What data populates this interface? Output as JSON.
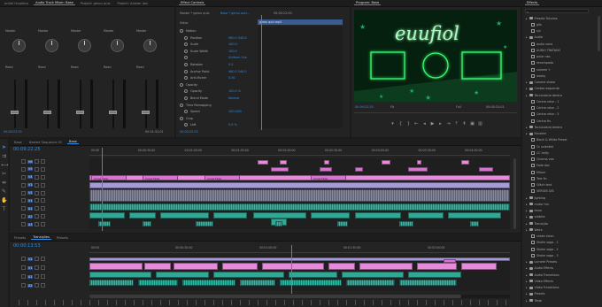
{
  "audio_mixer": {
    "tabs": [
      "ential Graphics",
      "Audio Track Mixer: Base",
      "Project: gerou quiz",
      "Project: Anexer doc"
    ],
    "strips": [
      {
        "route": "Master",
        "label": "Read",
        "db": "0.0"
      },
      {
        "route": "Master",
        "label": "Read",
        "db": "0.0"
      },
      {
        "route": "Master",
        "label": "Read",
        "db": "0.0"
      },
      {
        "route": "Master",
        "label": "Read",
        "db": "0.0"
      },
      {
        "route": "Master",
        "label": "Read",
        "db": "0.0"
      }
    ],
    "footer_left": "00:00:22:25",
    "footer_right": "00:01:31:01"
  },
  "effect_controls": {
    "tab": "Effect Controls",
    "title_left": "Master * gerou quiz.",
    "title_right": "Base * gerou quiz...",
    "video_label": "Video",
    "ruler_time": "00:00:22:00",
    "clip_label": "gerou quiz.mp4",
    "rows": [
      {
        "name": "Motion",
        "value": ""
      },
      {
        "name": "Position",
        "value": "960.0   540.0"
      },
      {
        "name": "Scale",
        "value": "100.0"
      },
      {
        "name": "Scale Width",
        "value": "100.0"
      },
      {
        "name": "",
        "value": "Uniform Sca"
      },
      {
        "name": "Rotation",
        "value": "0.0"
      },
      {
        "name": "Anchor Point",
        "value": "960.0   540.0"
      },
      {
        "name": "Anti-flicker",
        "value": "0.00"
      },
      {
        "name": "Opacity",
        "value": ""
      },
      {
        "name": "Opacity",
        "value": "100.0 %"
      },
      {
        "name": "Blend Mode",
        "value": "Normal"
      },
      {
        "name": "Time Remapping",
        "value": ""
      },
      {
        "name": "Speed",
        "value": "100.00%"
      },
      {
        "name": "Crop",
        "value": ""
      },
      {
        "name": "Left",
        "value": "0.0 %"
      }
    ],
    "footer_time": "00:00:22:25"
  },
  "program": {
    "tab": "Program: Base",
    "neon_text": "euufiol",
    "timecode": "00:09:22:25",
    "fit": "Fit",
    "quality": "Full",
    "duration": "00:00:31:01",
    "controls": [
      "marker-icon",
      "in-point-icon",
      "out-point-icon",
      "go-in-icon",
      "step-back-icon",
      "play-icon",
      "step-forward-icon",
      "go-out-icon",
      "lift-icon",
      "extract-icon",
      "export-frame-icon",
      "compare-icon"
    ]
  },
  "effects": {
    "tab": "Effects",
    "search_placeholder": "",
    "items": [
      {
        "label": "Presets Tuturais",
        "kind": "folder",
        "indent": 0
      },
      {
        "label": "gifs",
        "kind": "item",
        "indent": 1
      },
      {
        "label": "s/v",
        "kind": "item",
        "indent": 1
      },
      {
        "label": "Audio",
        "kind": "folder",
        "indent": 0
      },
      {
        "label": "audio vono",
        "kind": "item",
        "indent": 1
      },
      {
        "label": "AUDIO TRATADO",
        "kind": "item",
        "indent": 1
      },
      {
        "label": "pular nbs",
        "kind": "item",
        "indent": 1
      },
      {
        "label": "reverbpada",
        "kind": "item",
        "indent": 1
      },
      {
        "label": "volume +",
        "kind": "item",
        "indent": 1
      },
      {
        "label": "wacky",
        "kind": "item",
        "indent": 1
      },
      {
        "label": "Camera shake",
        "kind": "folder",
        "indent": 0
      },
      {
        "label": "Centeo esquerda",
        "kind": "folder",
        "indent": 0
      },
      {
        "label": "Tecnicolaria dentro",
        "kind": "folder",
        "indent": 0
      },
      {
        "label": "Centro rotor - 1",
        "kind": "item",
        "indent": 1
      },
      {
        "label": "Centro rotor - 2",
        "kind": "item",
        "indent": 1
      },
      {
        "label": "Centro rotor - 3",
        "kind": "item",
        "indent": 1
      },
      {
        "label": "Centro fix",
        "kind": "item",
        "indent": 1
      },
      {
        "label": "Tecnicolaria dentro",
        "kind": "folder",
        "indent": 0
      },
      {
        "label": "Escalem",
        "kind": "folder",
        "indent": 0
      },
      {
        "label": "Black & White Preset",
        "kind": "item",
        "indent": 1
      },
      {
        "label": "Cc scientist",
        "kind": "item",
        "indent": 1
      },
      {
        "label": "CC helty",
        "kind": "item",
        "indent": 1
      },
      {
        "label": "Cinema vee",
        "kind": "item",
        "indent": 1
      },
      {
        "label": "Fade dos",
        "kind": "item",
        "indent": 1
      },
      {
        "label": "Missnr",
        "kind": "item",
        "indent": 1
      },
      {
        "label": "Tela fin",
        "kind": "item",
        "indent": 1
      },
      {
        "label": "Glitch text",
        "kind": "item",
        "indent": 1
      },
      {
        "label": "VERSES DIS",
        "kind": "item",
        "indent": 1
      },
      {
        "label": "lighting",
        "kind": "folder",
        "indent": 0
      },
      {
        "label": "mutar fun",
        "kind": "folder",
        "indent": 0
      },
      {
        "label": "fama",
        "kind": "folder",
        "indent": 0
      },
      {
        "label": "volalita",
        "kind": "folder",
        "indent": 0
      },
      {
        "label": "Transição",
        "kind": "folder",
        "indent": 0
      },
      {
        "label": "Weirs",
        "kind": "folder",
        "indent": 0
      },
      {
        "label": "shake clean",
        "kind": "item",
        "indent": 1
      },
      {
        "label": "Shake vaga - 1",
        "kind": "item",
        "indent": 1
      },
      {
        "label": "Shake vaga - 2",
        "kind": "item",
        "indent": 1
      },
      {
        "label": "Shake vaga - 3",
        "kind": "item",
        "indent": 1
      },
      {
        "label": "Lumetri Presets",
        "kind": "folder",
        "indent": 0
      },
      {
        "label": "Audio Effects",
        "kind": "folder",
        "indent": 0
      },
      {
        "label": "Audio Transitions",
        "kind": "folder",
        "indent": 0
      },
      {
        "label": "Video Effects",
        "kind": "folder",
        "indent": 0
      },
      {
        "label": "Video Transitions",
        "kind": "folder",
        "indent": 0
      },
      {
        "label": "Presets",
        "kind": "folder",
        "indent": 0
      },
      {
        "label": "Teste",
        "kind": "folder",
        "indent": 0
      }
    ]
  },
  "tools": [
    "selection-icon",
    "track-select-icon",
    "ripple-edit-icon",
    "razor-icon",
    "slip-icon",
    "pen-icon",
    "hand-icon",
    "type-icon"
  ],
  "timeline_main": {
    "tabs": [
      "Base",
      "Nested Sequence 01",
      "Base"
    ],
    "timecode": "00:09:22:25",
    "ruler": [
      "00:00",
      "00:00:30:00",
      "00:01:00:00",
      "00:01:30:00",
      "00:02:00:00",
      "00:02:30:00",
      "00:03:00:00",
      "00:03:30:00",
      "00:04:00:00"
    ],
    "video_tracks": [
      {
        "name": "V6"
      },
      {
        "name": "V5"
      },
      {
        "name": "V4"
      },
      {
        "name": "V3"
      },
      {
        "name": "V2"
      },
      {
        "name": "V1"
      }
    ],
    "audio_tracks": [
      {
        "name": "A1"
      },
      {
        "name": "A2"
      },
      {
        "name": "A3"
      }
    ],
    "clip_label": "Cross Fade"
  },
  "timeline_bottom": {
    "tabs": [
      "Presets",
      "Transições",
      "Presets"
    ],
    "timecode": "00:00:13:53",
    "ruler": [
      "00:00",
      "00:00:30:00",
      "00:01:00:00",
      "00:01:30:00",
      "00:02:00:00"
    ],
    "tracks": [
      "V2",
      "V1",
      "A1",
      "A2"
    ]
  },
  "colors": {
    "accent": "#2d8ceb",
    "clip_pink": "#e58bd9",
    "clip_teal": "#2fa995",
    "neon": "#39ff6e"
  }
}
